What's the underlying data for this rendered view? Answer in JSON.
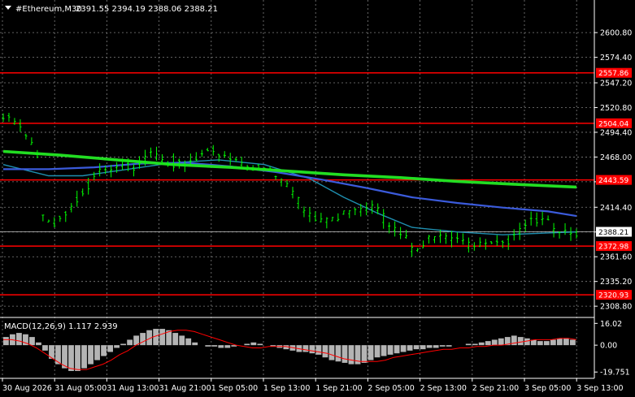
{
  "header": {
    "symbol_tf": "#Ethereum,M30",
    "ohlc": "2391.55 2394.19 2388.06 2388.21"
  },
  "macd": {
    "label": "MACD(12,26,9) 1.117 2.939"
  },
  "colors": {
    "background": "#000000",
    "grid": "#7f7f7f",
    "candle": "#00ff00",
    "level_line": "#ff0000",
    "ma_fast": "#1f8fb0",
    "ma_slow": "#3b5bdb",
    "ma_long": "#22dd22",
    "macd_hist": "#b4b4b4",
    "macd_signal": "#ff0000"
  },
  "chart_data": {
    "type": "candlestick",
    "y_axis": {
      "ticks": [
        "2600.80",
        "2574.40",
        "2547.20",
        "2520.80",
        "2494.40",
        "2468.00",
        "2441.60",
        "2414.40",
        "2388.00",
        "2361.60",
        "2335.20",
        "2308.80"
      ],
      "ylim": [
        2302,
        2620
      ]
    },
    "x_axis": {
      "ticks": [
        "30 Aug 2026",
        "31 Aug 05:00",
        "31 Aug 13:00",
        "31 Aug 21:00",
        "1 Sep 05:00",
        "1 Sep 13:00",
        "1 Sep 21:00",
        "2 Sep 05:00",
        "2 Sep 13:00",
        "2 Sep 21:00",
        "3 Sep 05:00",
        "3 Sep 13:00"
      ]
    },
    "current_price": "2388.21",
    "levels": [
      {
        "value": 2557.86,
        "label": "2557.86"
      },
      {
        "value": 2504.04,
        "label": "2504.04"
      },
      {
        "value": 2443.59,
        "label": "2443.59"
      },
      {
        "value": 2372.98,
        "label": "2372.98"
      },
      {
        "value": 2320.93,
        "label": "2320.93"
      }
    ],
    "price_path": [
      [
        0,
        2510
      ],
      [
        3,
        2500
      ],
      [
        6,
        2468
      ],
      [
        7,
        2405
      ],
      [
        9,
        2400
      ],
      [
        11,
        2410
      ],
      [
        14,
        2432
      ],
      [
        17,
        2450
      ],
      [
        20,
        2452
      ],
      [
        23,
        2460
      ],
      [
        26,
        2476
      ],
      [
        29,
        2465
      ],
      [
        32,
        2458
      ],
      [
        35,
        2468
      ],
      [
        38,
        2474
      ],
      [
        41,
        2466
      ],
      [
        44,
        2456
      ],
      [
        47,
        2452
      ],
      [
        50,
        2435
      ],
      [
        53,
        2412
      ],
      [
        56,
        2402
      ],
      [
        59,
        2405
      ],
      [
        62,
        2408
      ],
      [
        65,
        2412
      ],
      [
        68,
        2398
      ],
      [
        71,
        2385
      ],
      [
        72,
        2372
      ],
      [
        75,
        2378
      ],
      [
        78,
        2380
      ],
      [
        81,
        2376
      ],
      [
        84,
        2378
      ],
      [
        87,
        2382
      ],
      [
        90,
        2380
      ],
      [
        93,
        2398
      ],
      [
        96,
        2396
      ],
      [
        99,
        2392
      ],
      [
        101,
        2388
      ]
    ],
    "series": [
      {
        "name": "MA fast",
        "points": [
          [
            0,
            2460
          ],
          [
            8,
            2448
          ],
          [
            14,
            2448
          ],
          [
            22,
            2455
          ],
          [
            30,
            2462
          ],
          [
            38,
            2465
          ],
          [
            46,
            2460
          ],
          [
            54,
            2445
          ],
          [
            60,
            2425
          ],
          [
            66,
            2408
          ],
          [
            72,
            2393
          ],
          [
            80,
            2388
          ],
          [
            88,
            2385
          ],
          [
            96,
            2387
          ],
          [
            101,
            2388
          ]
        ]
      },
      {
        "name": "MA mid",
        "points": [
          [
            0,
            2455
          ],
          [
            8,
            2455
          ],
          [
            16,
            2457
          ],
          [
            24,
            2461
          ],
          [
            32,
            2462
          ],
          [
            40,
            2458
          ],
          [
            48,
            2452
          ],
          [
            56,
            2444
          ],
          [
            64,
            2435
          ],
          [
            72,
            2425
          ],
          [
            80,
            2419
          ],
          [
            88,
            2414
          ],
          [
            96,
            2410
          ],
          [
            101,
            2405
          ]
        ]
      },
      {
        "name": "MA long",
        "points": [
          [
            0,
            2474
          ],
          [
            10,
            2470
          ],
          [
            20,
            2465
          ],
          [
            30,
            2460
          ],
          [
            40,
            2457
          ],
          [
            50,
            2453
          ],
          [
            60,
            2449
          ],
          [
            70,
            2446
          ],
          [
            80,
            2442
          ],
          [
            90,
            2439
          ],
          [
            101,
            2436
          ]
        ]
      }
    ],
    "macd_axis": {
      "ticks": [
        "16.02",
        "0.00",
        "-19.751"
      ],
      "ylim": [
        -22,
        18
      ]
    },
    "macd_hist": [
      6,
      8,
      9,
      8,
      6,
      2,
      -4,
      -10,
      -14,
      -17,
      -19,
      -19,
      -17,
      -14,
      -11,
      -8,
      -5,
      -2,
      1,
      4,
      7,
      9,
      11,
      12,
      12,
      11,
      9,
      7,
      5,
      2,
      0,
      -1,
      -1,
      -2,
      -2,
      -1,
      0,
      1,
      2,
      1,
      0,
      -1,
      -2,
      -3,
      -4,
      -5,
      -5,
      -6,
      -7,
      -9,
      -11,
      -12,
      -13,
      -14,
      -14,
      -13,
      -11,
      -9,
      -8,
      -7,
      -6,
      -5,
      -4,
      -3,
      -3,
      -2,
      -2,
      -1,
      -1,
      0,
      0,
      1,
      1,
      2,
      3,
      4,
      5,
      6,
      7,
      6,
      5,
      4,
      3,
      3,
      4,
      5,
      5,
      4
    ],
    "macd_signal": [
      4,
      4,
      3,
      1,
      -2,
      -6,
      -10,
      -14,
      -17,
      -18,
      -18,
      -16,
      -14,
      -11,
      -7,
      -4,
      0,
      3,
      6,
      8,
      10,
      11,
      11,
      10,
      8,
      6,
      4,
      2,
      0,
      -1,
      -2,
      -2,
      -1,
      -1,
      -1,
      -2,
      -3,
      -4,
      -5,
      -6,
      -8,
      -10,
      -11,
      -12,
      -12,
      -12,
      -11,
      -9,
      -8,
      -7,
      -6,
      -5,
      -4,
      -3,
      -3,
      -2,
      -2,
      -1,
      -1,
      0,
      0,
      1,
      2,
      3,
      4,
      4,
      4,
      5,
      5,
      4
    ]
  }
}
